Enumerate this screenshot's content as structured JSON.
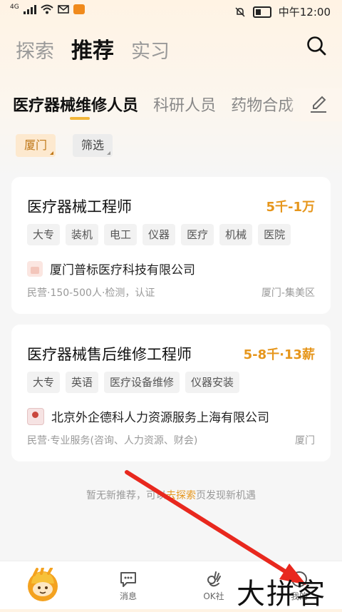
{
  "status_bar": {
    "network": "4G",
    "time": "中午12:00"
  },
  "top_tabs": [
    {
      "label": "探索",
      "active": false
    },
    {
      "label": "推荐",
      "active": true
    },
    {
      "label": "实习",
      "active": false
    }
  ],
  "categories": [
    {
      "label": "医疗器械维修人员",
      "active": true
    },
    {
      "label": "科研人员",
      "active": false
    },
    {
      "label": "药物合成",
      "active": false
    }
  ],
  "filters": {
    "city": "厦门",
    "filter": "筛选"
  },
  "jobs": [
    {
      "title": "医疗器械工程师",
      "salary": "5千-1万",
      "tags": [
        "大专",
        "装机",
        "电工",
        "仪器",
        "医疗",
        "机械",
        "医院"
      ],
      "company": "厦门普标医疗科技有限公司",
      "meta": "民营·150-500人·检测，认证",
      "location": "厦门-集美区"
    },
    {
      "title": "医疗器械售后维修工程师",
      "salary": "5-8千·13薪",
      "tags": [
        "大专",
        "英语",
        "医疗设备维修",
        "仪器安装"
      ],
      "company": "北京外企德科人力资源服务上海有限公司",
      "meta": "民营·专业服务(咨询、人力资源、财会)",
      "location": "厦门"
    }
  ],
  "empty_hint": {
    "before": "暂无新推荐，可以",
    "link": "去探索",
    "after": "页发现新机遇"
  },
  "bottom_nav": [
    {
      "label": "消息"
    },
    {
      "label": "OK社"
    },
    {
      "label": "我的"
    }
  ],
  "watermark": "大拼客",
  "colors": {
    "accent": "#e6961c",
    "underline": "#f2b63a",
    "arrow": "#e8281e"
  }
}
